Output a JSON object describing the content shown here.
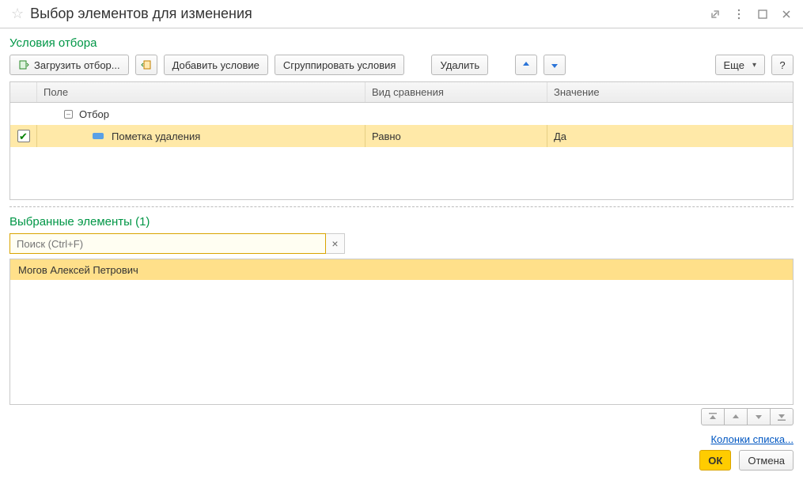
{
  "window": {
    "title": "Выбор элементов для изменения"
  },
  "sections": {
    "filter_title": "Условия отбора",
    "selected_title": "Выбранные элементы (1)"
  },
  "toolbar": {
    "load_filter": "Загрузить отбор...",
    "add_condition": "Добавить условие",
    "group_conditions": "Сгруппировать условия",
    "delete": "Удалить",
    "more": "Еще",
    "help": "?"
  },
  "filter_table": {
    "headers": {
      "field": "Поле",
      "compare": "Вид сравнения",
      "value": "Значение"
    },
    "rows": [
      {
        "kind": "group",
        "checked": null,
        "field": "Отбор",
        "compare": "",
        "value": ""
      },
      {
        "kind": "leaf",
        "checked": true,
        "field": "Пометка удаления",
        "compare": "Равно",
        "value": "Да"
      }
    ]
  },
  "search": {
    "placeholder": "Поиск (Ctrl+F)",
    "value": ""
  },
  "selected_list": [
    "Могов Алексей Петрович"
  ],
  "link": {
    "columns": "Колонки списка..."
  },
  "footer": {
    "ok": "ОК",
    "cancel": "Отмена"
  }
}
